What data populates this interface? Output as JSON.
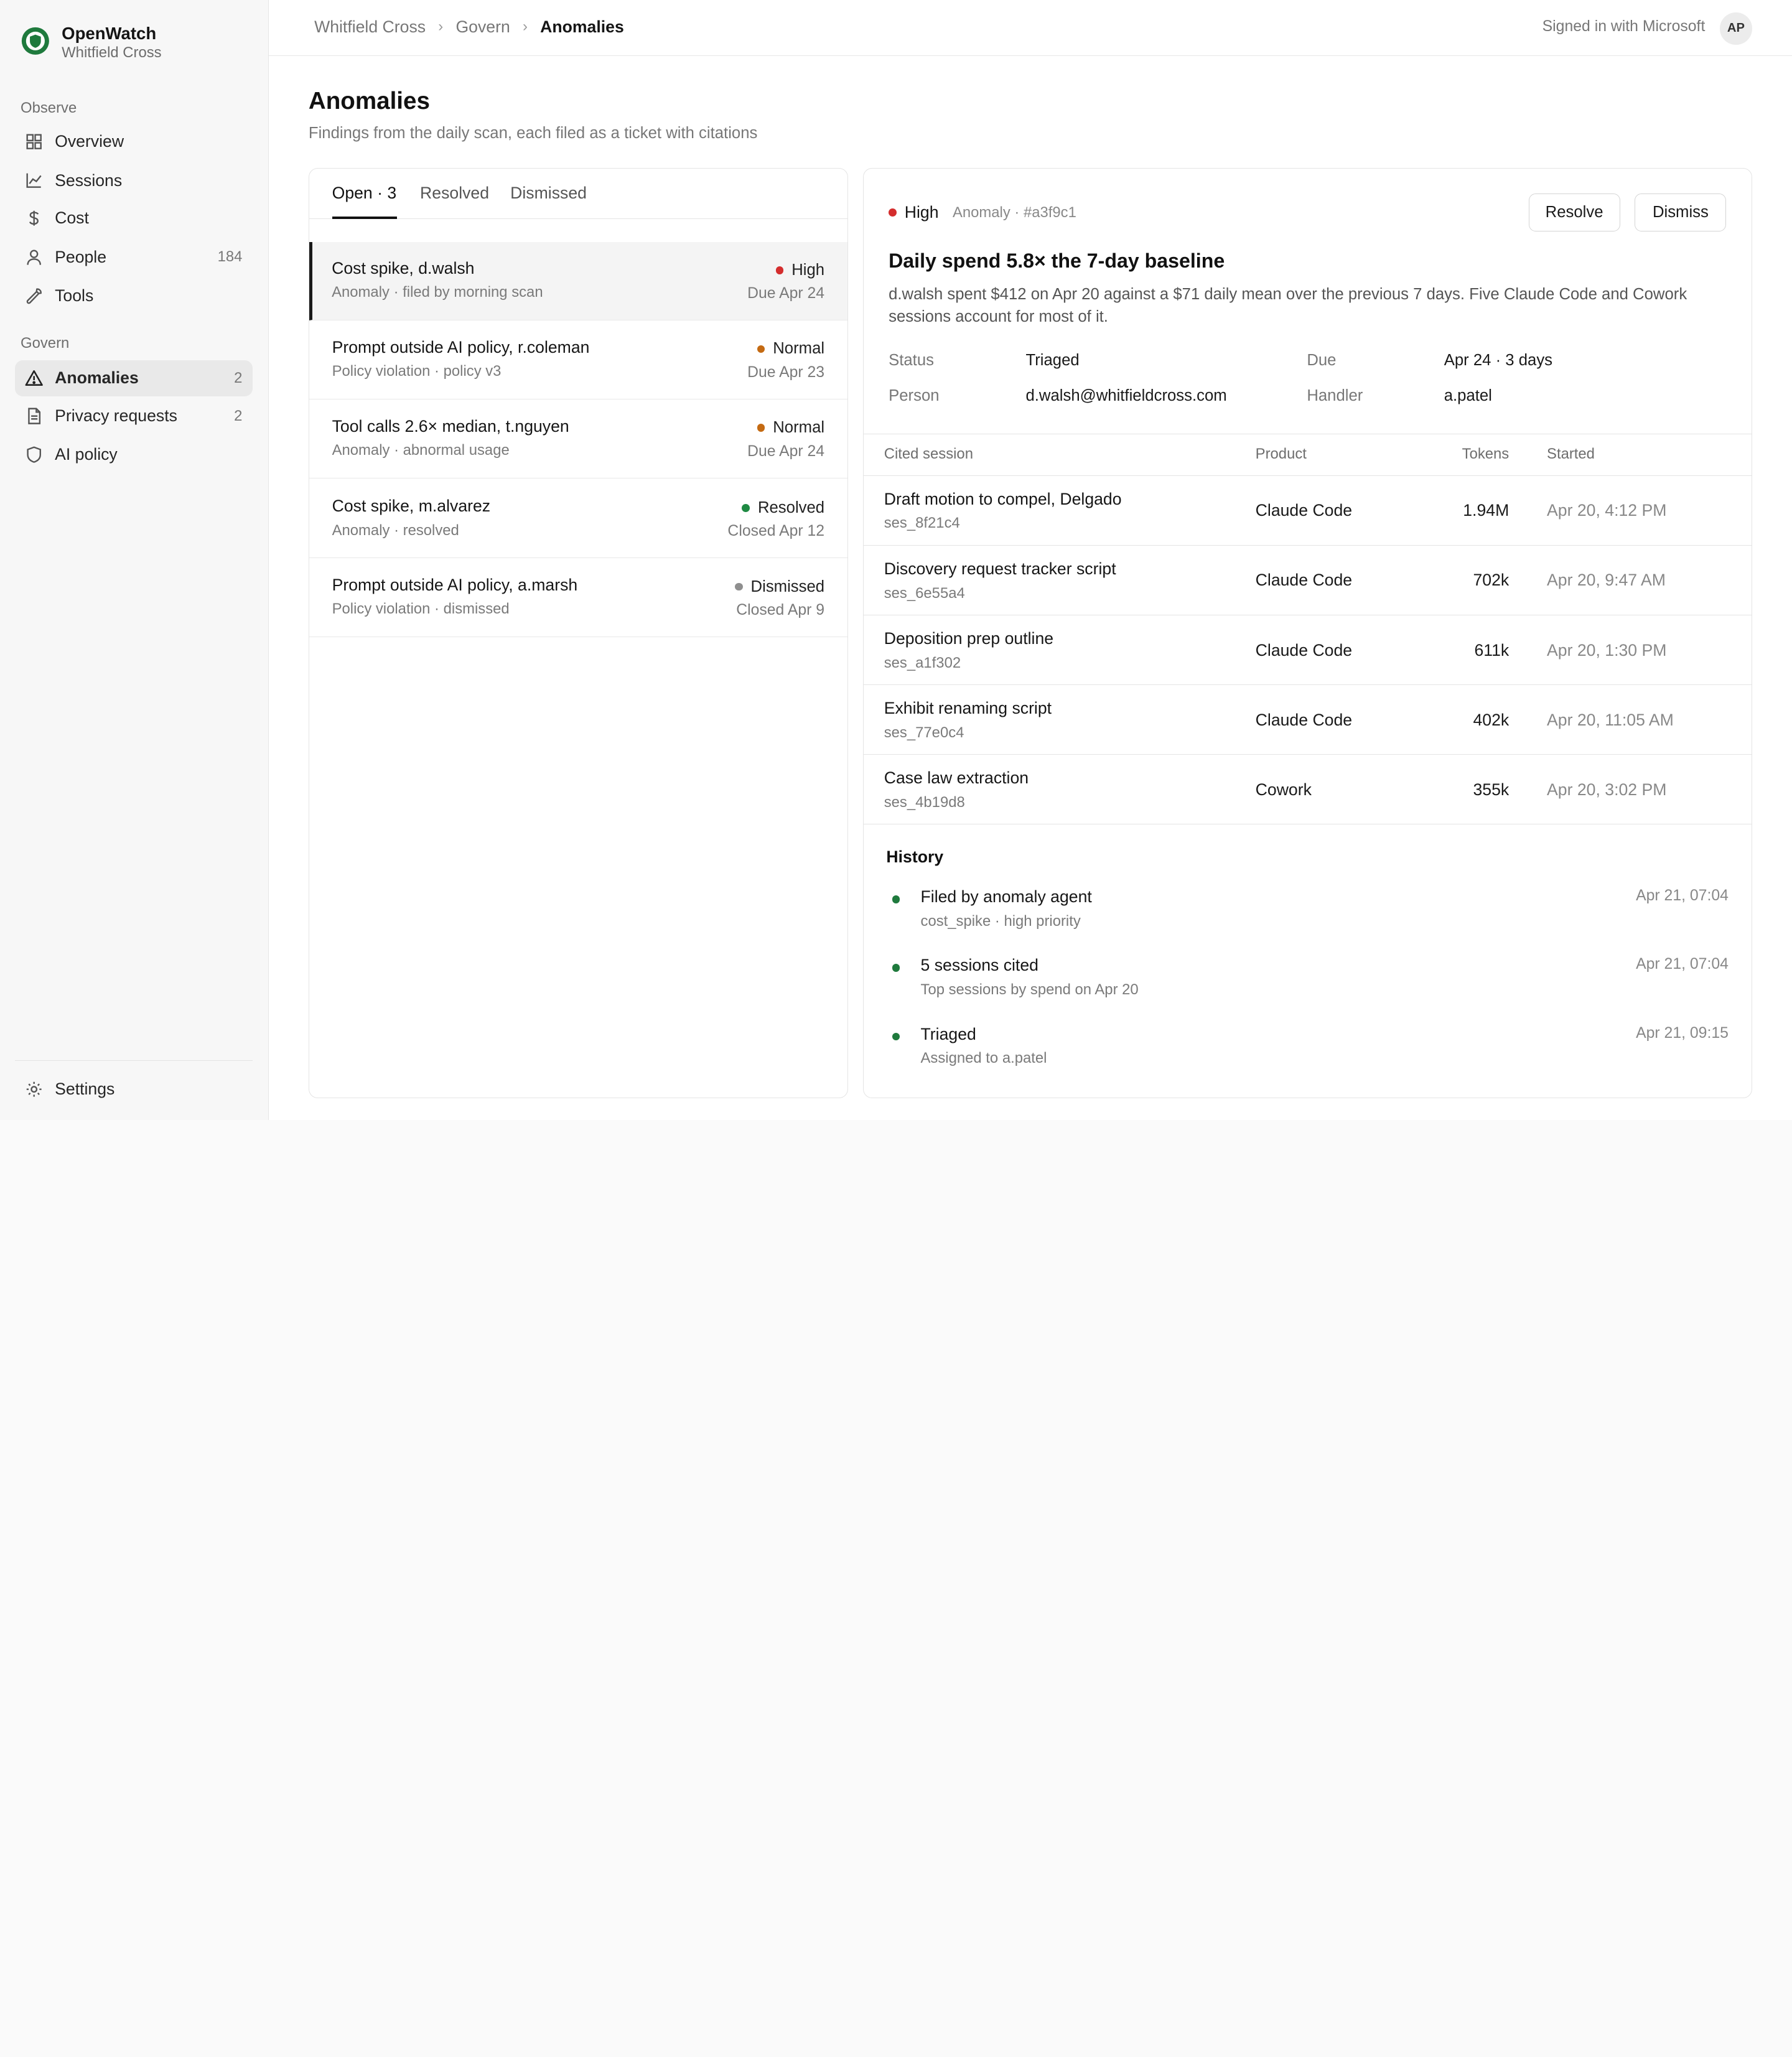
{
  "brand": {
    "name": "OpenWatch",
    "org": "Whitfield Cross"
  },
  "sidebar": {
    "observe_label": "Observe",
    "govern_label": "Govern",
    "observe_items": [
      {
        "label": "Overview",
        "icon": "grid-icon",
        "count": ""
      },
      {
        "label": "Sessions",
        "icon": "chart-line-icon",
        "count": ""
      },
      {
        "label": "Cost",
        "icon": "dollar-icon",
        "count": ""
      },
      {
        "label": "People",
        "icon": "person-icon",
        "count": "184"
      },
      {
        "label": "Tools",
        "icon": "wrench-icon",
        "count": ""
      }
    ],
    "govern_items": [
      {
        "label": "Anomalies",
        "icon": "warning-icon",
        "count": "2"
      },
      {
        "label": "Privacy requests",
        "icon": "document-icon",
        "count": "2"
      },
      {
        "label": "AI policy",
        "icon": "shield-icon",
        "count": ""
      }
    ],
    "settings_label": "Settings"
  },
  "topbar": {
    "breadcrumb": [
      "Whitfield Cross",
      "Govern",
      "Anomalies"
    ],
    "signed_in": "Signed in with Microsoft",
    "avatar": "AP"
  },
  "page": {
    "title": "Anomalies",
    "subtitle": "Findings from the daily scan, each filed as a ticket with citations"
  },
  "tabs": [
    "Open · 3",
    "Resolved",
    "Dismissed"
  ],
  "tickets": [
    {
      "title": "Cost spike, d.walsh",
      "meta": "Anomaly · filed by morning scan",
      "status": "High",
      "status_color": "#d42d2d",
      "due": "Due Apr 24"
    },
    {
      "title": "Prompt outside AI policy, r.coleman",
      "meta": "Policy violation · policy v3",
      "status": "Normal",
      "status_color": "#c46a12",
      "due": "Due Apr 23"
    },
    {
      "title": "Tool calls 2.6× median, t.nguyen",
      "meta": "Anomaly · abnormal usage",
      "status": "Normal",
      "status_color": "#c46a12",
      "due": "Due Apr 24"
    },
    {
      "title": "Cost spike, m.alvarez",
      "meta": "Anomaly · resolved",
      "status": "Resolved",
      "status_color": "#1f8a43",
      "due": "Closed Apr 12"
    },
    {
      "title": "Prompt outside AI policy, a.marsh",
      "meta": "Policy violation · dismissed",
      "status": "Dismissed",
      "status_color": "#8f8f8f",
      "due": "Closed Apr 9"
    }
  ],
  "detail": {
    "severity": "High",
    "severity_color": "#d42d2d",
    "meta": "Anomaly · #a3f9c1",
    "resolve_label": "Resolve",
    "dismiss_label": "Dismiss",
    "title": "Daily spend 5.8× the 7-day baseline",
    "description": "d.walsh spent $412 on Apr 20 against a $71 daily mean over the previous 7 days. Five Claude Code and Cowork sessions account for most of it.",
    "fields": {
      "status_label": "Status",
      "status": "Triaged",
      "due_label": "Due",
      "due": "Apr 24 · 3 days",
      "person_label": "Person",
      "person": "d.walsh@whitfieldcross.com",
      "handler_label": "Handler",
      "handler": "a.patel"
    },
    "sessions_headers": [
      "Cited session",
      "Product",
      "Tokens",
      "Started"
    ],
    "sessions": [
      {
        "title": "Draft motion to compel, Delgado",
        "id": "ses_8f21c4",
        "product": "Claude Code",
        "tokens": "1.94M",
        "started": "Apr 20, 4:12 PM"
      },
      {
        "title": "Discovery request tracker script",
        "id": "ses_6e55a4",
        "product": "Claude Code",
        "tokens": "702k",
        "started": "Apr 20, 9:47 AM"
      },
      {
        "title": "Deposition prep outline",
        "id": "ses_a1f302",
        "product": "Claude Code",
        "tokens": "611k",
        "started": "Apr 20, 1:30 PM"
      },
      {
        "title": "Exhibit renaming script",
        "id": "ses_77e0c4",
        "product": "Claude Code",
        "tokens": "402k",
        "started": "Apr 20, 11:05 AM"
      },
      {
        "title": "Case law extraction",
        "id": "ses_4b19d8",
        "product": "Cowork",
        "tokens": "355k",
        "started": "Apr 20, 3:02 PM"
      }
    ],
    "history_title": "History",
    "history": [
      {
        "title": "Filed by anomaly agent",
        "sub": "cost_spike · high priority",
        "time": "Apr 21, 07:04"
      },
      {
        "title": "5 sessions cited",
        "sub": "Top sessions by spend on Apr 20",
        "time": "Apr 21, 07:04"
      },
      {
        "title": "Triaged",
        "sub": "Assigned to a.patel",
        "time": "Apr 21, 09:15"
      }
    ]
  }
}
